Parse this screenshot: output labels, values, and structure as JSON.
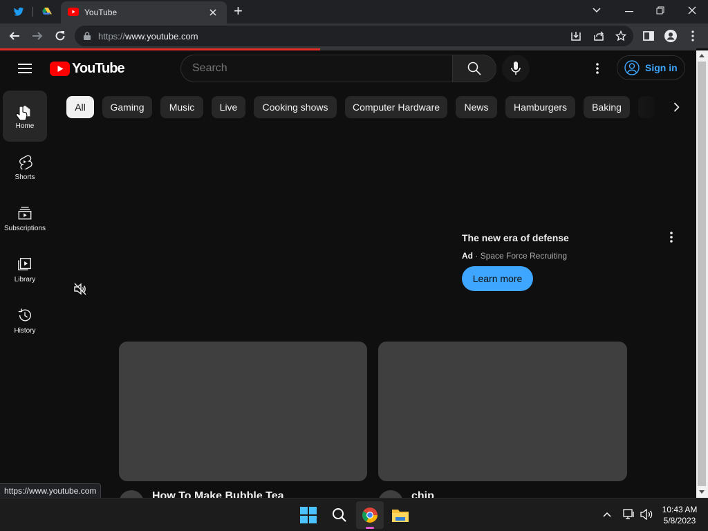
{
  "browser": {
    "tab_title": "YouTube",
    "url_scheme": "https://",
    "url_host": "www.youtube.com",
    "new_tab_symbol": "+",
    "pinned_tabs": [
      "twitter-icon",
      "google-drive-icon"
    ],
    "page_load_progress": 0.46
  },
  "youtube": {
    "logo_text": "YouTube",
    "search": {
      "placeholder": "Search"
    },
    "sign_in_label": "Sign in",
    "sidebar": {
      "items": [
        {
          "label": "Home",
          "icon": "home-icon",
          "active": true
        },
        {
          "label": "Shorts",
          "icon": "shorts-icon",
          "active": false
        },
        {
          "label": "Subscriptions",
          "icon": "subscriptions-icon",
          "active": false
        },
        {
          "label": "Library",
          "icon": "library-icon",
          "active": false
        },
        {
          "label": "History",
          "icon": "history-icon",
          "active": false
        }
      ]
    },
    "chips": [
      "All",
      "Gaming",
      "Music",
      "Live",
      "Cooking shows",
      "Computer Hardware",
      "News",
      "Hamburgers",
      "Baking"
    ],
    "ad": {
      "title": "The new era of defense",
      "badge": "Ad",
      "separator": "·",
      "advertiser": "Space Force Recruiting",
      "cta": "Learn more"
    },
    "videos": [
      {
        "title": "How To Make Bubble Tea"
      },
      {
        "title": "chip"
      }
    ]
  },
  "status_bar_url": "https://www.youtube.com",
  "taskbar": {
    "time": "10:43 AM",
    "date": "5/8/2023"
  },
  "colors": {
    "accent_blue": "#3ea6ff",
    "youtube_red": "#ff0000",
    "page_bg": "#0f0f0f"
  }
}
